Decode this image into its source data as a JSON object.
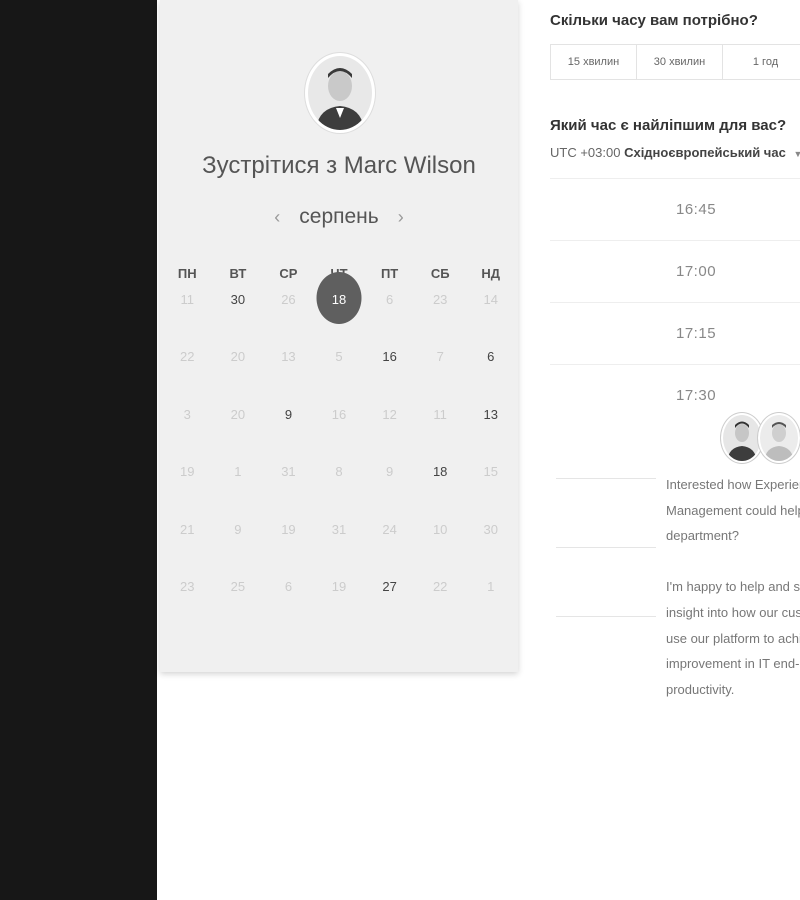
{
  "calendar": {
    "title": "Зустрітися з Marc Wilson",
    "month": "серпень",
    "prev_arrow": "‹",
    "next_arrow": "›",
    "weekdays": [
      "ПН",
      "ВТ",
      "СР",
      "ЧТ",
      "ПТ",
      "СБ",
      "НД"
    ],
    "weeks": [
      [
        "11",
        "30",
        "26",
        "18",
        "6",
        "23",
        "14"
      ],
      [
        "22",
        "20",
        "13",
        "5",
        "16",
        "7",
        "6"
      ],
      [
        "3",
        "20",
        "9",
        "16",
        "12",
        "11",
        "13"
      ],
      [
        "19",
        "1",
        "31",
        "8",
        "9",
        "18",
        "15"
      ],
      [
        "21",
        "9",
        "19",
        "31",
        "24",
        "10",
        "30"
      ],
      [
        "23",
        "25",
        "6",
        "19",
        "27",
        "22",
        "1"
      ]
    ],
    "active_days": [
      [
        0,
        1
      ],
      [
        0,
        3
      ],
      [
        1,
        4
      ],
      [
        1,
        6
      ],
      [
        2,
        2
      ],
      [
        2,
        6
      ],
      [
        3,
        5
      ],
      [
        5,
        4
      ]
    ],
    "selected_day": [
      0,
      3
    ]
  },
  "booking": {
    "duration_question": "Скільки часу вам потрібно?",
    "durations": [
      "15 хвилин",
      "30 хвилин",
      "1 год"
    ],
    "time_question": "Який час є найліпшим для вас?",
    "timezone_offset": "UTC +03:00",
    "timezone_name": "Східноєвропейський час",
    "slots": [
      "16:45",
      "17:00",
      "17:15",
      "17:30"
    ]
  },
  "chat": {
    "message_1": [
      "Interested how Experien",
      "Management could help",
      "department?"
    ],
    "message_2": [
      "I'm happy to help and sh",
      "insight into how our cust",
      "use our platform to achi",
      "improvement in IT end-u",
      "productivity."
    ]
  },
  "colors": {
    "dark_sidebar": "#171717",
    "calendar_bg": "#f0f0f0",
    "selected_day": "#5f5f5f"
  }
}
